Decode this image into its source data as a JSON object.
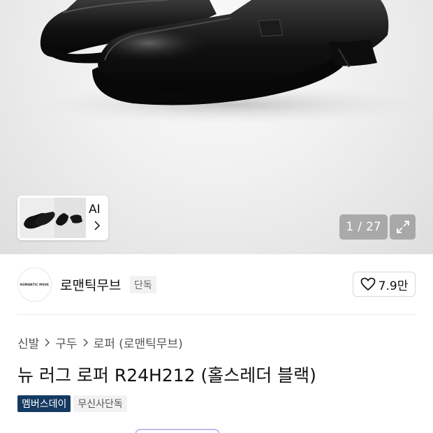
{
  "gallery": {
    "current": "1",
    "separator": "/",
    "total": "27",
    "thumb_label": "AI"
  },
  "brand": {
    "logo_text": "ROMANTIC MOVE",
    "name": "로맨틱무브",
    "badge": "단독",
    "like_count": "7.9만"
  },
  "breadcrumb": [
    {
      "label": "신발"
    },
    {
      "label": "구두"
    },
    {
      "label": "로퍼 (로맨틱무브)"
    }
  ],
  "product": {
    "title": "뉴 러그 로퍼 R24H212 (홀스레더 블랙)",
    "tags": [
      "멤버스데이",
      "무신사단독"
    ]
  },
  "icons": {
    "expand": "expand-icon",
    "heart": "heart-icon",
    "chevron": "chevron-right-icon"
  },
  "colors": {
    "tag_dark": "#153a62",
    "peek_border": "#c7b8f0"
  }
}
